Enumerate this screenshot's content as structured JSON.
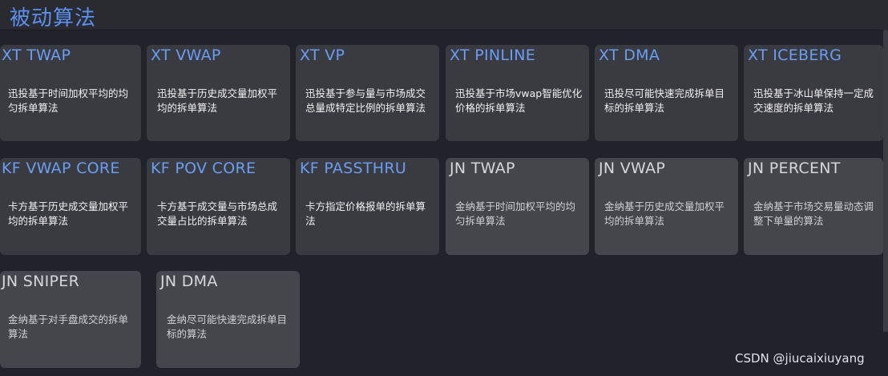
{
  "header": {
    "title": "被动算法"
  },
  "cards": [
    {
      "title": "XT TWAP",
      "desc": "迅投基于时间加权平均的均匀拆单算法"
    },
    {
      "title": "XT VWAP",
      "desc": "迅投基于历史成交量加权平均的拆单算法"
    },
    {
      "title": "XT VP",
      "desc": "迅投基于参与量与市场成交总量成特定比例的拆单算法"
    },
    {
      "title": "XT PINLINE",
      "desc": "迅投基于市场vwap智能优化价格的拆单算法"
    },
    {
      "title": "XT DMA",
      "desc": "迅投尽可能快速完成拆单目标的拆单算法"
    },
    {
      "title": "XT ICEBERG",
      "desc": "迅投基于冰山单保持一定成交速度的拆单算法"
    },
    {
      "title": "KF VWAP CORE",
      "desc": "卡方基于历史成交量加权平均的拆单算法"
    },
    {
      "title": "KF POV CORE",
      "desc": "卡方基于成交量与市场总成交量占比的拆单算法"
    },
    {
      "title": "KF PASSTHRU",
      "desc": "卡方指定价格报单的拆单算法"
    },
    {
      "title": "JN TWAP",
      "desc": "金纳基于时间加权平均的均匀拆单算法"
    },
    {
      "title": "JN VWAP",
      "desc": "金纳基于历史成交量加权平均的拆单算法"
    },
    {
      "title": "JN PERCENT",
      "desc": "金纳基于市场交易量动态调整下单量的算法"
    },
    {
      "title": "JN SNIPER",
      "desc": "金纳基于对手盘成交的拆单算法"
    },
    {
      "title": "JN DMA",
      "desc": "金纳尽可能快速完成拆单目标的算法"
    }
  ],
  "watermark": "CSDN @jiucaixiuyang"
}
